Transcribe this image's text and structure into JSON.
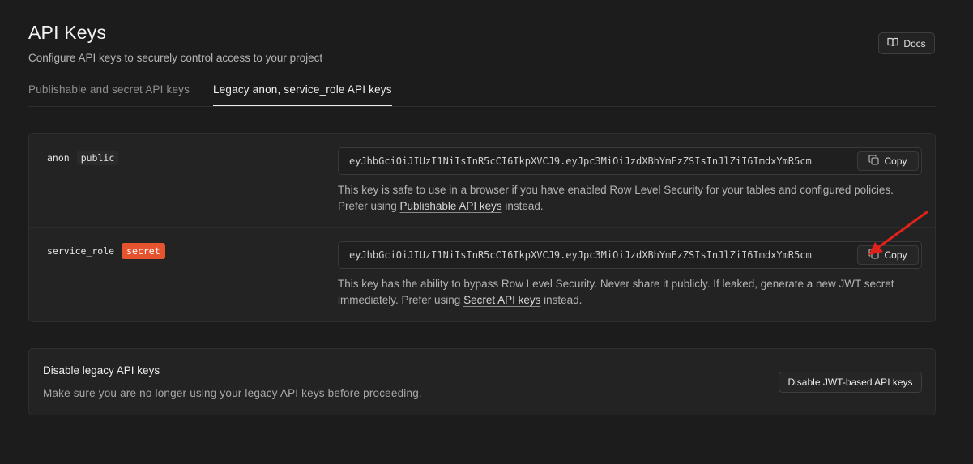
{
  "header": {
    "title": "API Keys",
    "subtitle": "Configure API keys to securely control access to your project",
    "docs_label": "Docs"
  },
  "tabs": [
    {
      "label": "Publishable and secret API keys",
      "active": false
    },
    {
      "label": "Legacy anon, service_role API keys",
      "active": true
    }
  ],
  "keys": [
    {
      "role": "anon",
      "badge": "public",
      "value": "eyJhbGciOiJIUzI1NiIsInR5cCI6IkpXVCJ9.eyJpc3MiOiJzdXBhYmFzZSIsInJlZiI6ImdxYmR5cm",
      "copy_label": "Copy",
      "desc_pre": "This key is safe to use in a browser if you have enabled Row Level Security for your tables and configured policies. Prefer using ",
      "desc_link": "Publishable API keys",
      "desc_post": " instead."
    },
    {
      "role": "service_role",
      "badge": "secret",
      "value": "eyJhbGciOiJIUzI1NiIsInR5cCI6IkpXVCJ9.eyJpc3MiOiJzdXBhYmFzZSIsInJlZiI6ImdxYmR5cm",
      "copy_label": "Copy",
      "desc_pre": "This key has the ability to bypass Row Level Security. Never share it publicly. If leaked, generate a new JWT secret immediately. Prefer using ",
      "desc_link": "Secret API keys",
      "desc_post": " instead."
    }
  ],
  "disable_section": {
    "title": "Disable legacy API keys",
    "description": "Make sure you are no longer using your legacy API keys before proceeding.",
    "button_label": "Disable JWT-based API keys"
  },
  "colors": {
    "background": "#1c1c1c",
    "card": "#232323",
    "secret_badge": "#e5532f",
    "annotation_arrow": "#e0221b"
  },
  "icons": {
    "docs": "book-icon",
    "copy": "copy-icon"
  }
}
